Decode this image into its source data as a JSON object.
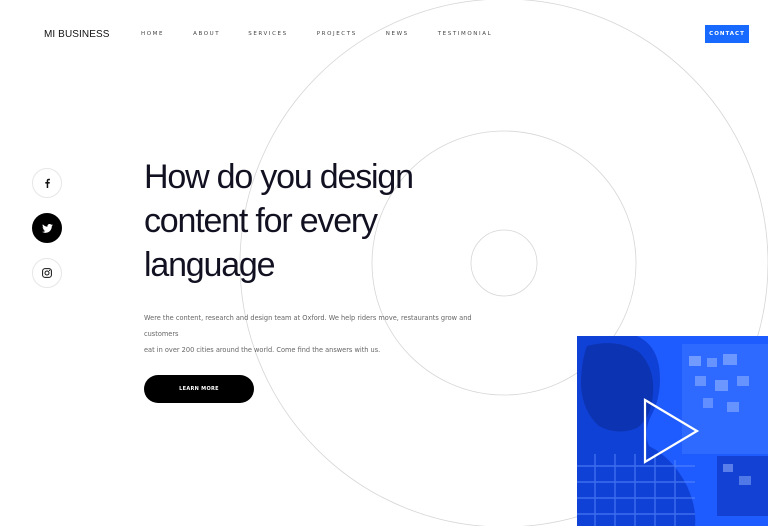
{
  "header": {
    "logo": "MI BUSINESS",
    "nav": [
      "HOME",
      "ABOUT",
      "SERVICES",
      "PROJECTS",
      "NEWS",
      "TESTIMONIAL"
    ],
    "contact_label": "CONTACT"
  },
  "social": {
    "icons": [
      "facebook-icon",
      "twitter-icon",
      "instagram-icon"
    ]
  },
  "hero": {
    "title_line1": "How do you design",
    "title_line2": "content for every",
    "title_line3": "language",
    "desc_line1": "Were the content, research and design team at Oxford. We help riders move, restaurants grow and customers",
    "desc_line2": "eat in over 200 cities around the world. Come find the answers with us.",
    "cta_label": "LEARN MORE"
  },
  "video": {
    "icon": "play-icon"
  },
  "colors": {
    "accent": "#1769ff",
    "video_overlay": "#1f5cff",
    "text": "#111122"
  }
}
